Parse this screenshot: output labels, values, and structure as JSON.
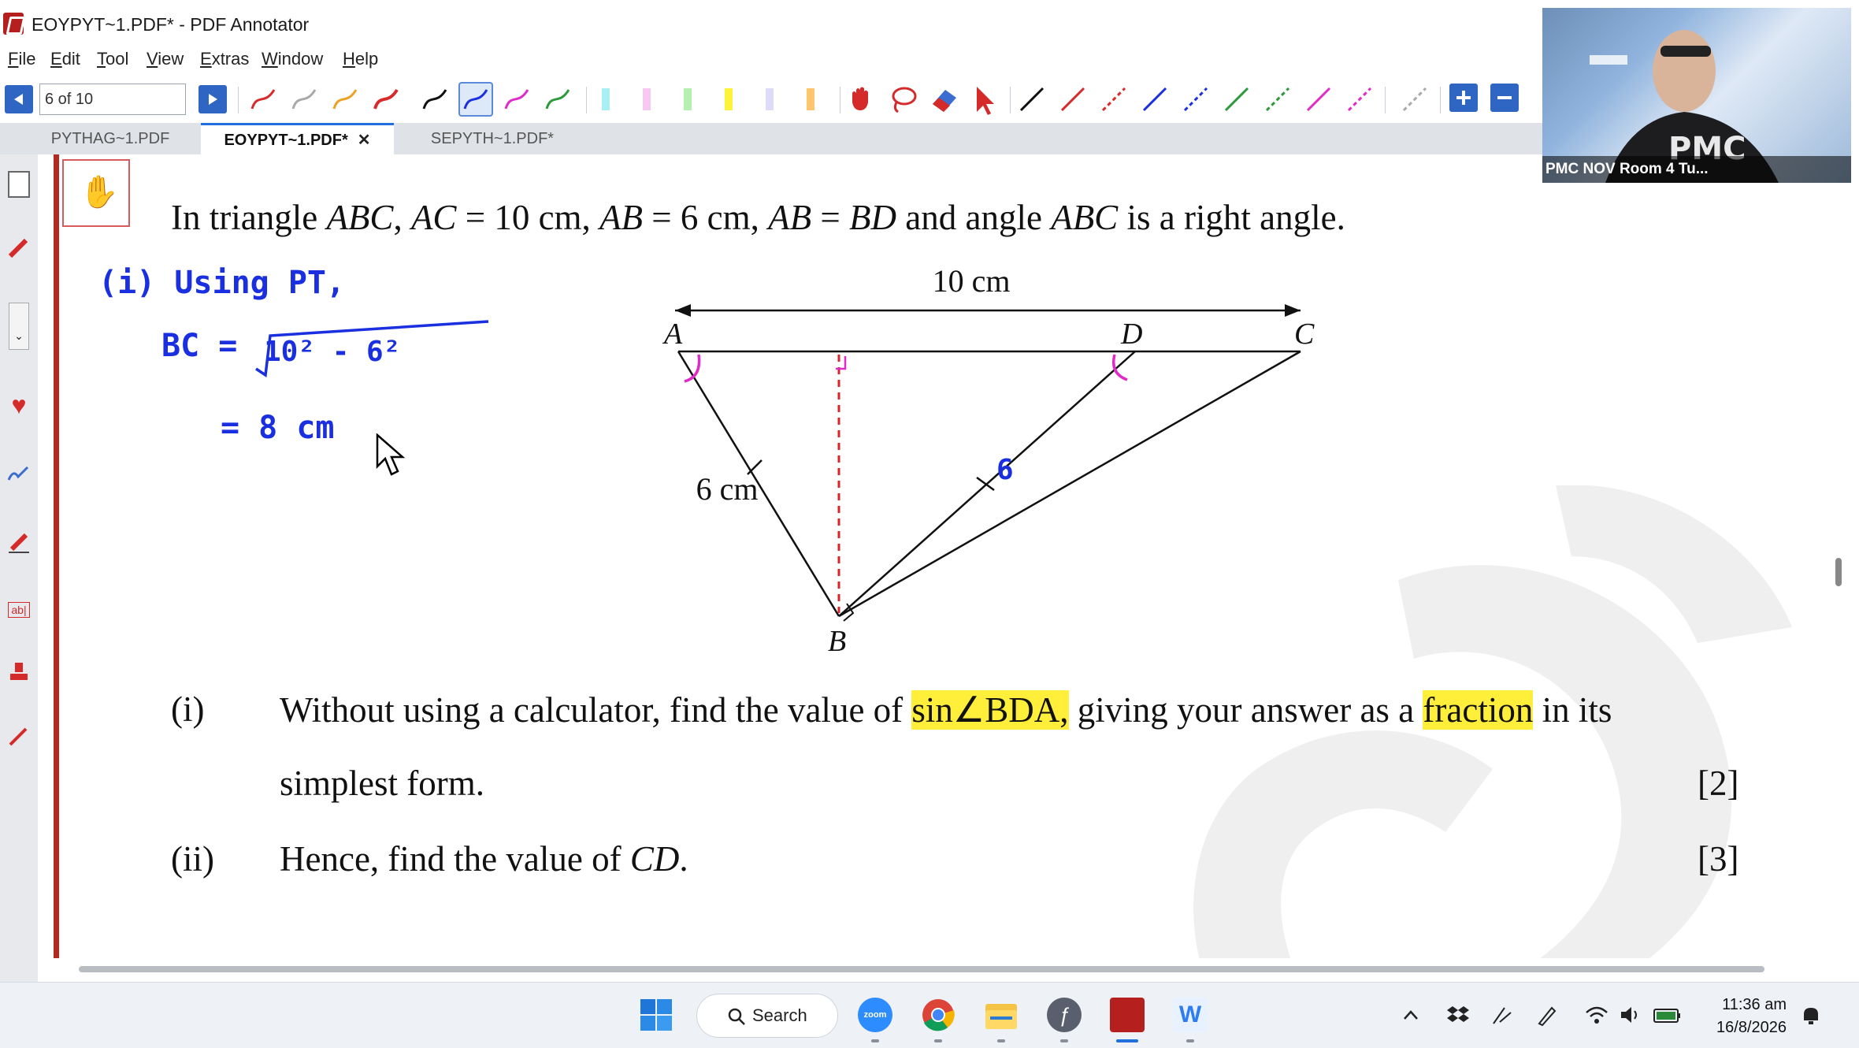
{
  "window": {
    "title": "EOYPYT~1.PDF* - PDF Annotator"
  },
  "menu": {
    "items": [
      "File",
      "Edit",
      "Tool",
      "View",
      "Extras",
      "Window",
      "Help"
    ]
  },
  "toolbar": {
    "page_indicator": "6 of 10"
  },
  "tabs": [
    {
      "label": "PYTHAG~1.PDF",
      "active": false
    },
    {
      "label": "EOYPYT~1.PDF*",
      "active": true,
      "close": "✕"
    },
    {
      "label": "SEPYTH~1.PDF*",
      "active": false
    }
  ],
  "webcam": {
    "label": "PMC NOV Room 4 Tu..."
  },
  "document": {
    "question_intro": {
      "p1": "In triangle ",
      "v1": "ABC",
      "p2": ", ",
      "v2": "AC",
      "p3": " = 10 cm, ",
      "v3": "AB",
      "p4": " = 6 cm, ",
      "v4": "AB",
      "p5": " = ",
      "v5": "BD",
      "p6": " and angle ",
      "v6": "ABC",
      "p7": " is a right angle."
    },
    "diagram": {
      "top_length": "10 cm",
      "left_length": "6 cm",
      "point_a": "A",
      "point_b": "B",
      "point_c": "C",
      "point_d": "D"
    },
    "handwriting": {
      "line1": "(i) Using PT,",
      "line2_lhs": "BC =",
      "line2_rad": "10² - 6²",
      "line3": "= 8 cm",
      "bd_mark": "6"
    },
    "part_i": {
      "num": "(i)",
      "text1": "Without using a calculator, find the value of ",
      "hl1": "sin∠BDA,",
      "text2": " giving your answer as a ",
      "hl2": "fraction",
      "text3": " in its",
      "text4": "simplest form.",
      "marks": "[2]"
    },
    "part_ii": {
      "num": "(ii)",
      "text1": "Hence, find the value of ",
      "var": "CD",
      "text2": ".",
      "marks": "[3]"
    }
  },
  "taskbar": {
    "search_label": "Search",
    "time": "11:36 am",
    "date": "16/8/2026"
  },
  "colors": {
    "accent_blue": "#2f66c4",
    "doc_border_red": "#b22a20",
    "highlight_yellow": "#ffee3a",
    "ink_blue": "#1a2fe0",
    "ink_magenta": "#e02bc8",
    "ink_red_dashed": "#d8242a"
  }
}
